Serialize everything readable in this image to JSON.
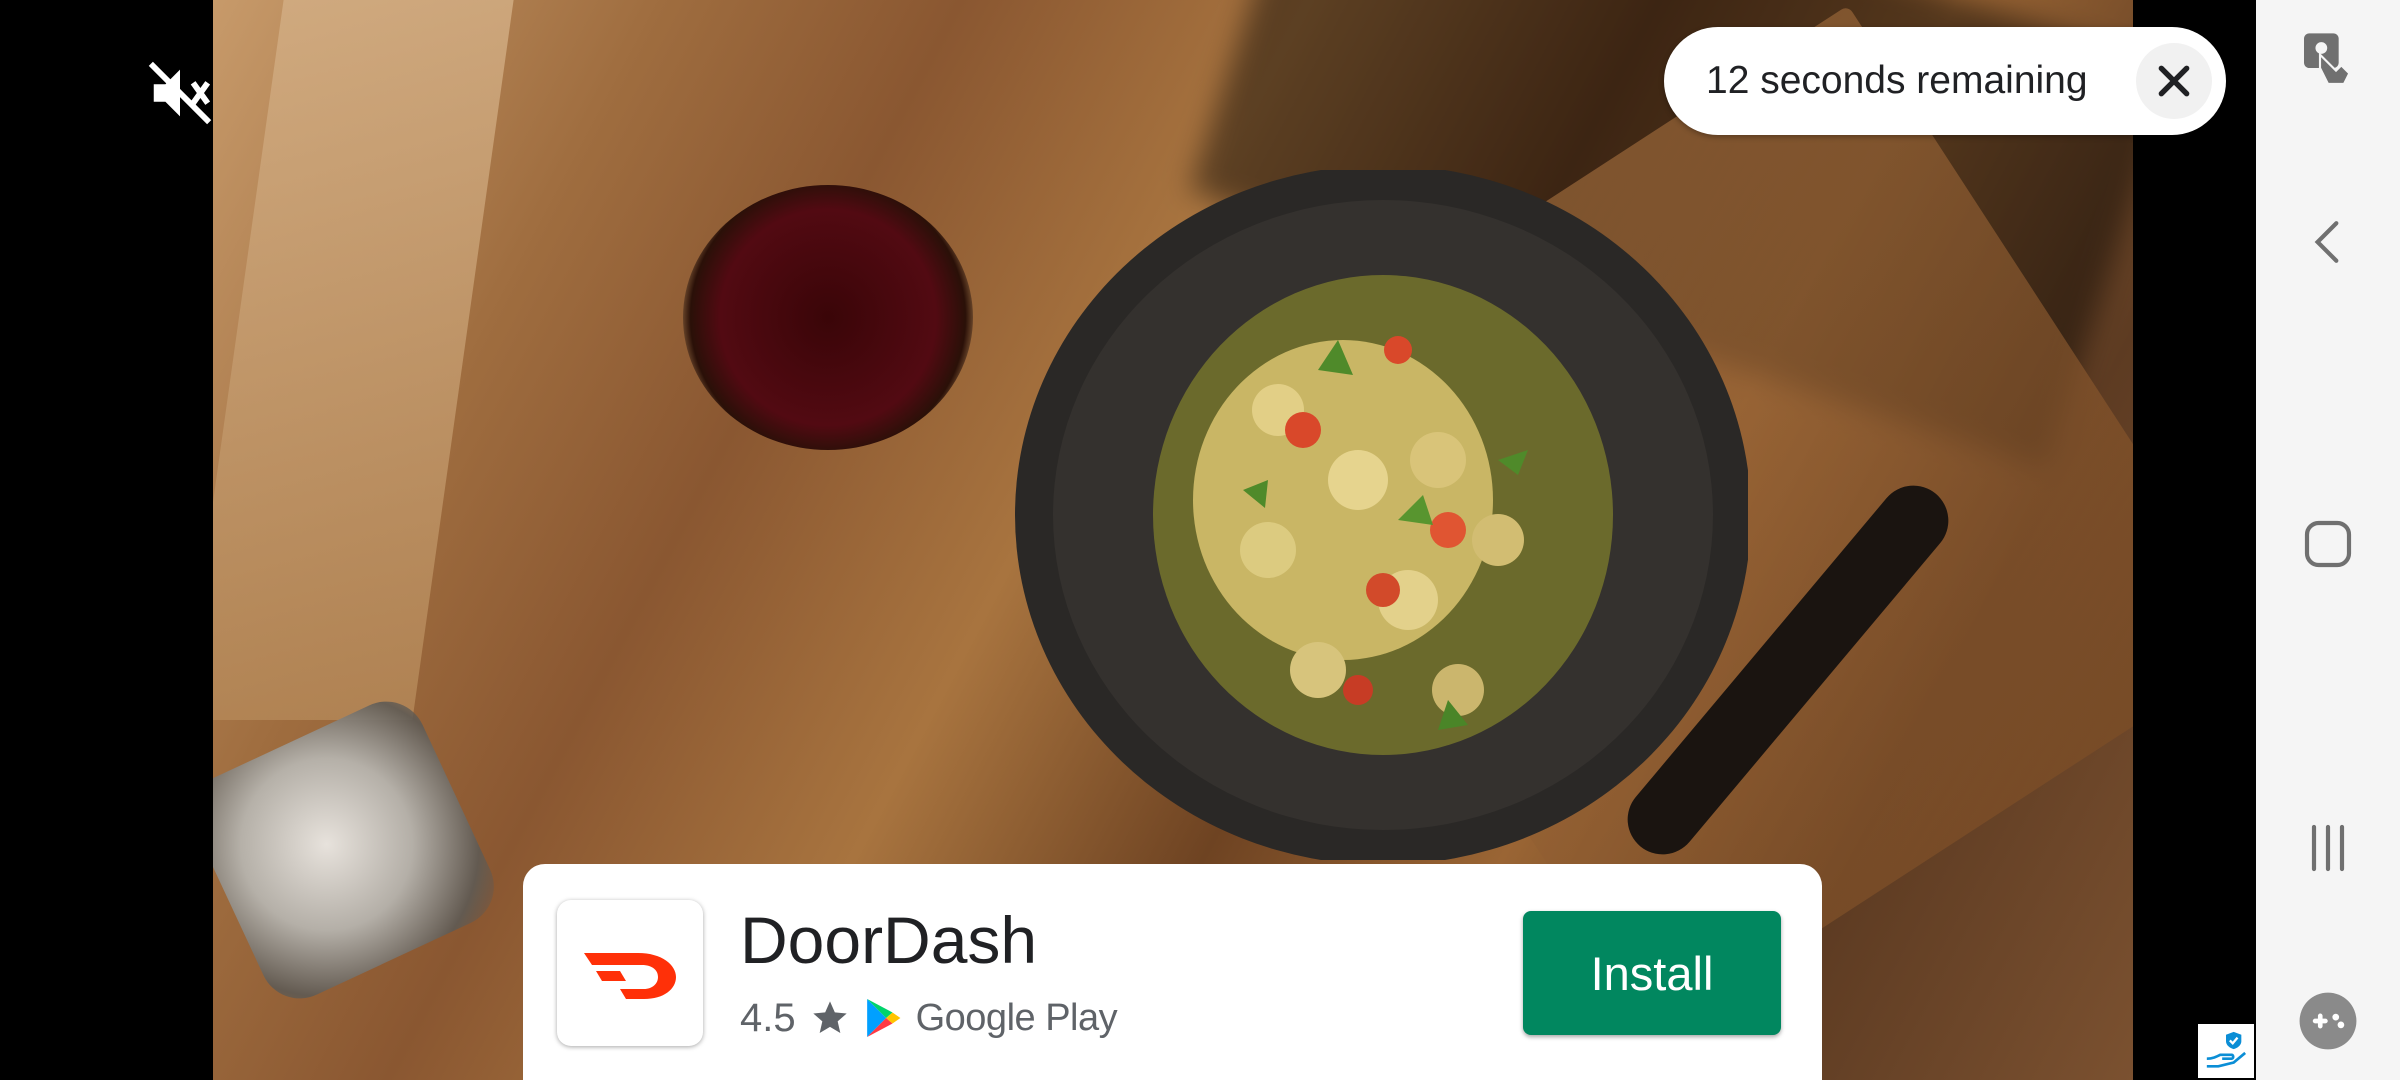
{
  "countdown": {
    "text": "12 seconds remaining"
  },
  "app": {
    "name": "DoorDash",
    "rating": "4.5",
    "store": "Google Play",
    "install_label": "Install",
    "brand_color": "#ff3008"
  },
  "colors": {
    "install_button": "#01875f",
    "navbar_bg": "#f5f5f5"
  },
  "icons": {
    "mute": "volume-muted-icon",
    "close": "close-icon",
    "touch_lock": "touch-lock-icon",
    "back": "back-icon",
    "home": "home-icon",
    "recents": "recents-icon",
    "game": "game-launcher-icon",
    "adchoices": "adchoices-icon"
  }
}
